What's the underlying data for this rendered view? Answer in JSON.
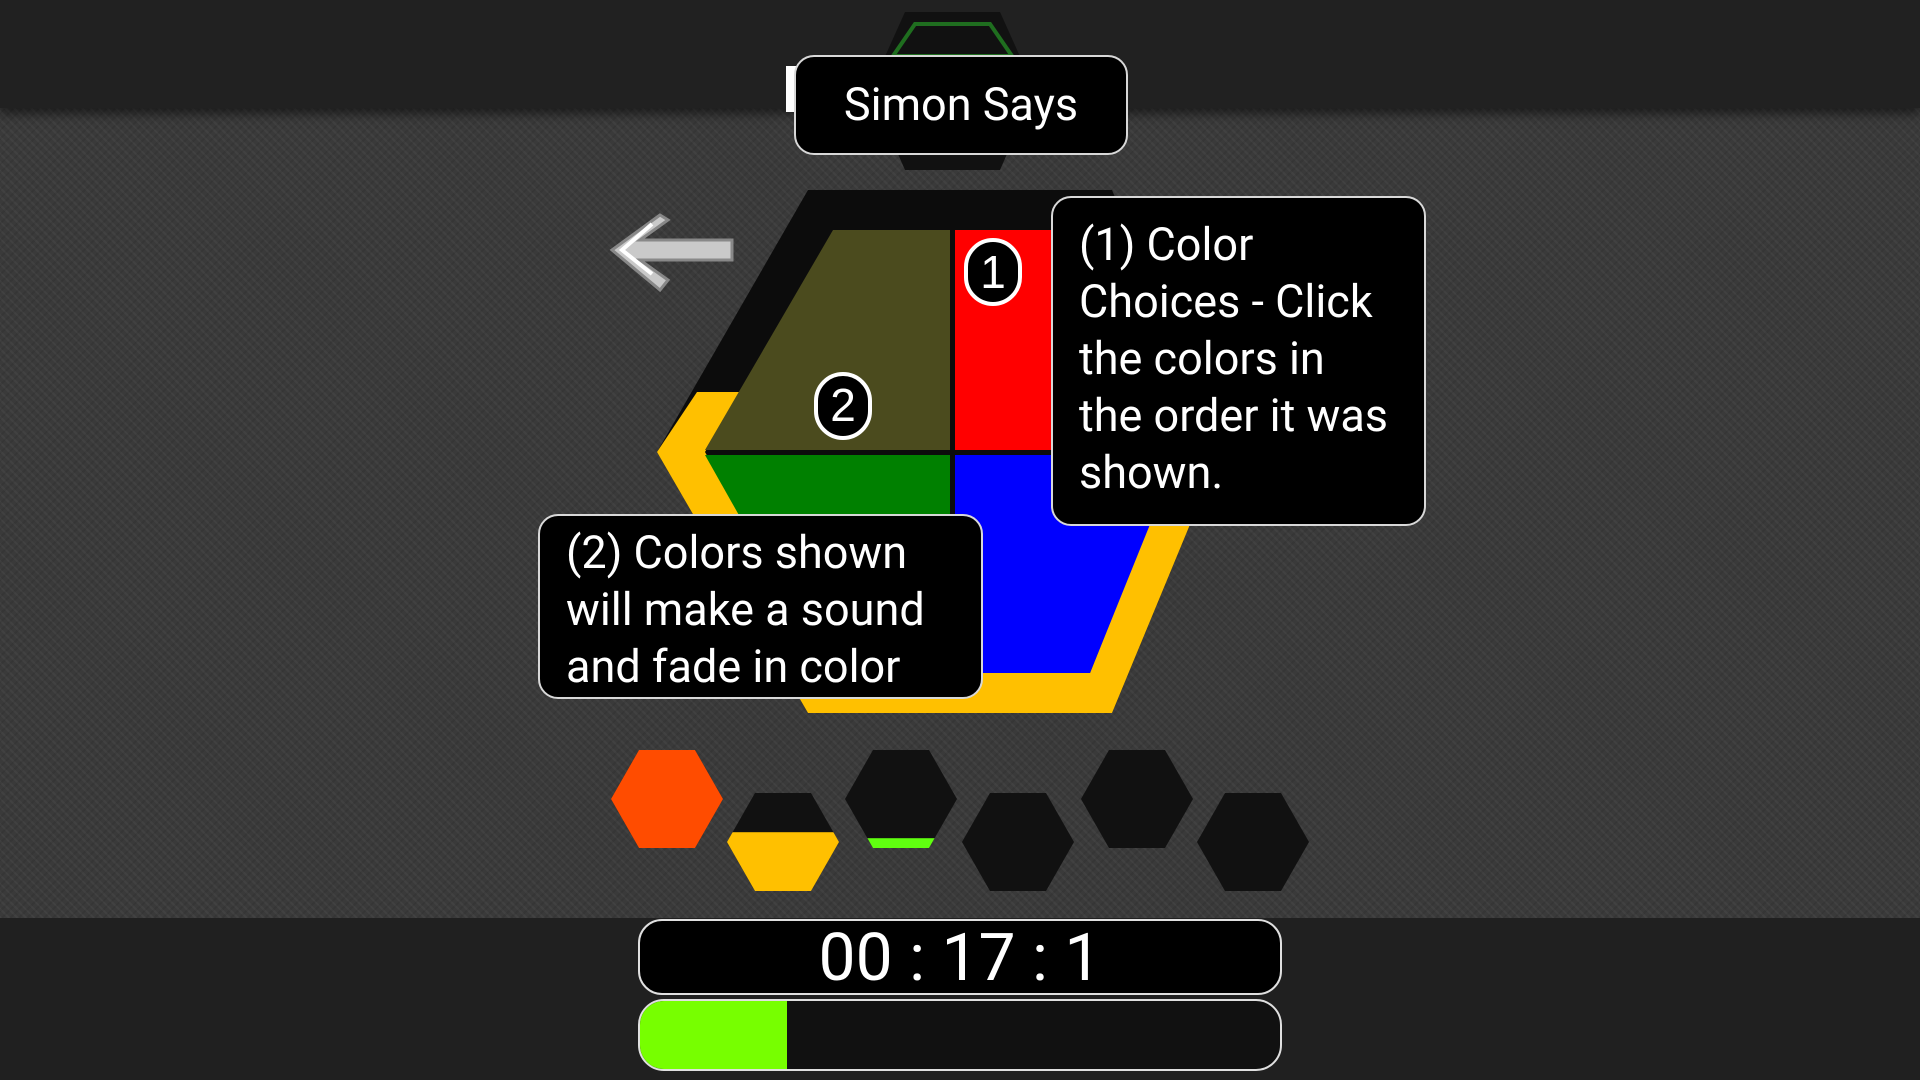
{
  "title": "Simon Says",
  "tooltips": {
    "color_choices": "(1) Color Choices - Click the colors in the order it was shown.",
    "colors_shown": "(2) Colors shown will make a sound and fade in color"
  },
  "markers": {
    "one": "1",
    "two": "2"
  },
  "board": {
    "quadrants": [
      {
        "name": "olive",
        "color": "#4b4b1e"
      },
      {
        "name": "red",
        "color": "#ff0000"
      },
      {
        "name": "green",
        "color": "#008000"
      },
      {
        "name": "blue",
        "color": "#0000ff"
      }
    ],
    "border_color": "#ffc000"
  },
  "sequence": [
    {
      "color": "#ff4c00",
      "level": 1.0
    },
    {
      "color": "#ffc000",
      "level": 0.6
    },
    {
      "color": "#60ff10",
      "level": 0.1
    },
    {
      "color": "#111111",
      "level": 0
    },
    {
      "color": "#111111",
      "level": 0
    },
    {
      "color": "#111111",
      "level": 0
    }
  ],
  "timer": "00 : 17 : 1",
  "progress": 0.23,
  "accent": "#77ff00"
}
